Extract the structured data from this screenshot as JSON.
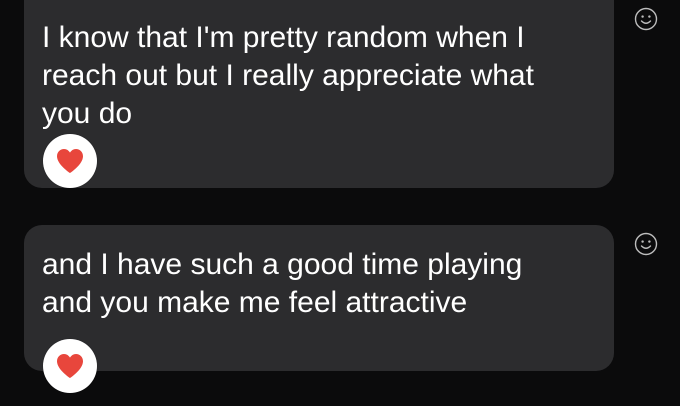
{
  "messages": [
    {
      "text": "I know that I'm pretty random when I\nreach out but I really appreciate what\nyou do",
      "reaction": "heart-icon"
    },
    {
      "text": "and I have such a good time playing\nand you make me feel attractive",
      "reaction": "heart-icon"
    }
  ],
  "colors": {
    "background": "#0b0b0c",
    "bubble": "#2c2c2e",
    "text": "#ffffff",
    "heart": "#e8463c",
    "reaction_bg": "#ffffff",
    "icon": "#bdbdbd"
  },
  "icons": {
    "react_button": "smiley-face-icon",
    "reaction": "heart-icon"
  }
}
